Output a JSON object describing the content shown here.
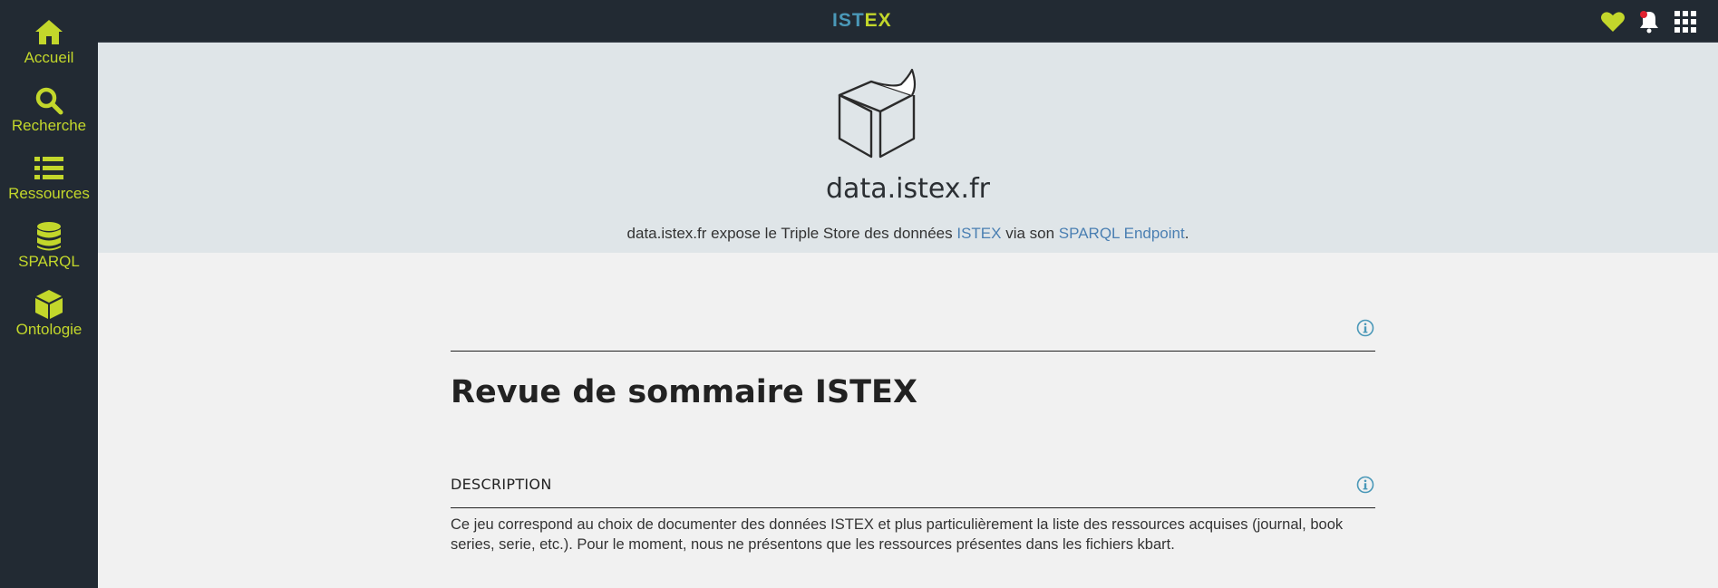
{
  "sidebar": {
    "items": [
      {
        "label": "Accueil",
        "icon": "home-icon"
      },
      {
        "label": "Recherche",
        "icon": "search-icon"
      },
      {
        "label": "Ressources",
        "icon": "list-icon"
      },
      {
        "label": "SPARQL",
        "icon": "database-icon"
      },
      {
        "label": "Ontologie",
        "icon": "cube-icon"
      }
    ]
  },
  "header": {
    "brand_part1": "IST",
    "brand_part2": "EX",
    "icons": [
      "heart-icon",
      "bell-icon",
      "apps-grid-icon"
    ]
  },
  "hero": {
    "title": "data.istex.fr",
    "desc_prefix": "data.istex.fr expose le Triple Store des données ",
    "link_istex": "ISTEX",
    "desc_middle": " via son ",
    "link_sparql": "SPARQL Endpoint",
    "desc_suffix": "."
  },
  "main": {
    "title": "Revue de sommaire ISTEX",
    "section_title": "DESCRIPTION",
    "section_text": "Ce jeu correspond au choix de documenter des données ISTEX et plus particulièrement la liste des ressources acquises (journal, book series, serie, etc.). Pour le moment, nous ne présentons que les ressources présentes dans les fichiers kbart."
  },
  "colors": {
    "accent": "#c3d72b",
    "brand_blue": "#4a98b8",
    "dark": "#222a33",
    "link": "#4a7fb2"
  }
}
